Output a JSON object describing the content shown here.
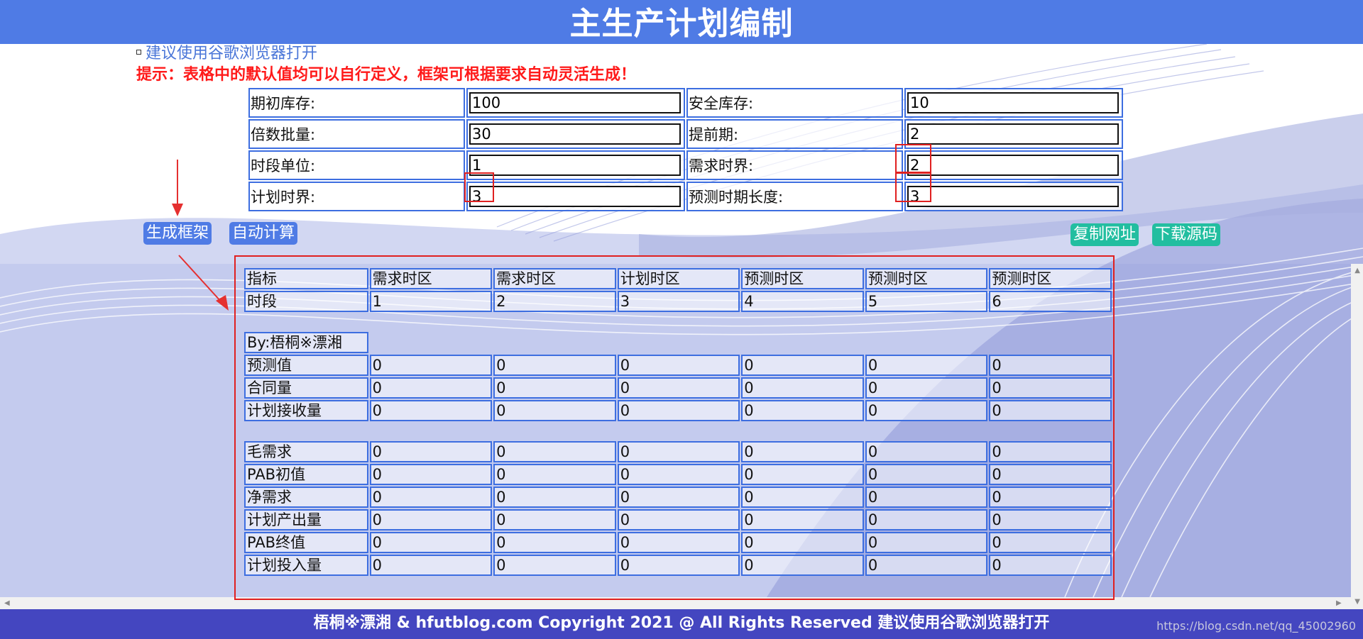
{
  "header": {
    "title": "主生产计划编制"
  },
  "notes": {
    "browser": "建议使用谷歌浏览器打开",
    "tip": "提示：表格中的默认值均可以自行定义，框架可根据要求自动灵活生成！"
  },
  "params": [
    {
      "label1": "期初库存:",
      "value1": "100",
      "label2": "安全库存:",
      "value2": "10"
    },
    {
      "label1": "倍数批量:",
      "value1": "30",
      "label2": "提前期:",
      "value2": "2"
    },
    {
      "label1": "时段单位:",
      "value1": "1",
      "label2": "需求时界:",
      "value2": "2"
    },
    {
      "label1": "计划时界:",
      "value1": "3",
      "label2": "预测时期长度:",
      "value2": "3"
    }
  ],
  "buttons": {
    "generate": "生成框架",
    "auto_calc": "自动计算",
    "copy_url": "复制网址",
    "download": "下载源码"
  },
  "grid": {
    "header_label": "指标",
    "zones": [
      "需求时区",
      "需求时区",
      "计划时区",
      "预测时区",
      "预测时区",
      "预测时区"
    ],
    "period_label": "时段",
    "periods": [
      "1",
      "2",
      "3",
      "4",
      "5",
      "6"
    ],
    "by_label": "By:梧桐※漂湘",
    "section1": [
      {
        "label": "预测值",
        "values": [
          "0",
          "0",
          "0",
          "0",
          "0",
          "0"
        ]
      },
      {
        "label": "合同量",
        "values": [
          "0",
          "0",
          "0",
          "0",
          "0",
          "0"
        ]
      },
      {
        "label": "计划接收量",
        "values": [
          "0",
          "0",
          "0",
          "0",
          "0",
          "0"
        ]
      }
    ],
    "section2": [
      {
        "label": "毛需求",
        "values": [
          "0",
          "0",
          "0",
          "0",
          "0",
          "0"
        ]
      },
      {
        "label": "PAB初值",
        "values": [
          "0",
          "0",
          "0",
          "0",
          "0",
          "0"
        ]
      },
      {
        "label": "净需求",
        "values": [
          "0",
          "0",
          "0",
          "0",
          "0",
          "0"
        ]
      },
      {
        "label": "计划产出量",
        "values": [
          "0",
          "0",
          "0",
          "0",
          "0",
          "0"
        ]
      },
      {
        "label": "PAB终值",
        "values": [
          "0",
          "0",
          "0",
          "0",
          "0",
          "0"
        ]
      },
      {
        "label": "计划投入量",
        "values": [
          "0",
          "0",
          "0",
          "0",
          "0",
          "0"
        ]
      }
    ]
  },
  "footer": {
    "text": "梧桐※漂湘 & hfutblog.com Copyright 2021 @ All Rights Reserved 建议使用谷歌浏览器打开"
  },
  "watermark": "https://blog.csdn.net/qq_45002960",
  "colors": {
    "accent": "#4f7be5",
    "teal": "#22bea0",
    "alert": "#ff1a1a",
    "footer": "#4446c0",
    "cell_border": "#3d6ee0"
  }
}
